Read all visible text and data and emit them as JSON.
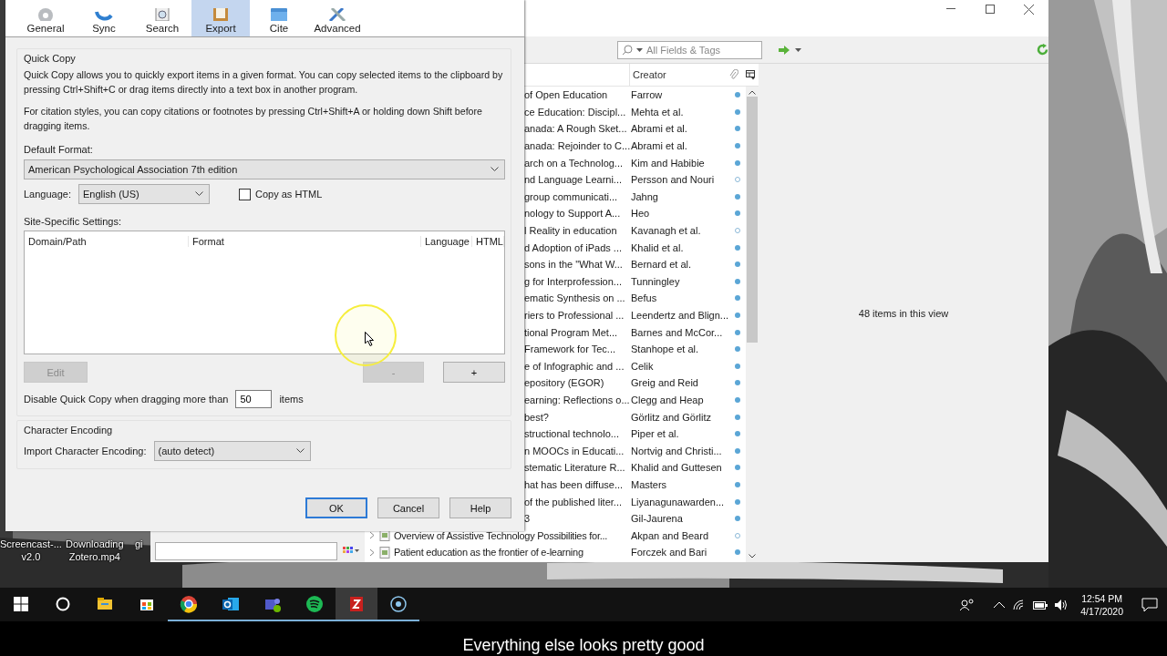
{
  "dialog": {
    "tabs": [
      {
        "label": "General",
        "selected": false
      },
      {
        "label": "Sync",
        "selected": false
      },
      {
        "label": "Search",
        "selected": false
      },
      {
        "label": "Export",
        "selected": true
      },
      {
        "label": "Cite",
        "selected": false
      },
      {
        "label": "Advanced",
        "selected": false
      }
    ],
    "quick_copy": {
      "legend": "Quick Copy",
      "paragraphs": [
        "Quick Copy allows you to quickly export items in a given format. You can copy selected items to the clipboard by pressing Ctrl+Shift+C or drag items directly into a text box in another program.",
        "For citation styles, you can copy citations or footnotes by pressing Ctrl+Shift+A or holding down Shift before dragging items."
      ],
      "default_format_label": "Default Format:",
      "default_format": "American Psychological Association 7th edition",
      "language_label": "Language:",
      "language": "English (US)",
      "copy_as_html": {
        "label": "Copy as HTML",
        "checked": false
      },
      "site_settings_label": "Site-Specific Settings:",
      "site_columns": [
        "Domain/Path",
        "Format",
        "Language",
        "HTML"
      ],
      "buttons": [
        {
          "label": "Edit",
          "disabled": true
        },
        {
          "label": "-",
          "disabled": true
        },
        {
          "label": "+",
          "disabled": false
        }
      ],
      "drag_limit": {
        "before": "Disable Quick Copy when dragging more than",
        "value": "50",
        "after": "items"
      }
    },
    "character_encoding": {
      "legend": "Character Encoding",
      "label": "Import Character Encoding:",
      "value": "(auto detect)"
    },
    "footer_buttons": [
      {
        "label": "OK",
        "default": true
      },
      {
        "label": "Cancel",
        "default": false
      },
      {
        "label": "Help",
        "default": false
      }
    ]
  },
  "zotero": {
    "search": {
      "placeholder": "All Fields & Tags"
    },
    "columns": [
      "Creator"
    ],
    "items": [
      {
        "kind": "clipped",
        "title": "of Open Education",
        "creator": "Farrow",
        "attached": true
      },
      {
        "kind": "clipped",
        "title": "ce Education: Discipl...",
        "creator": "Mehta et al.",
        "attached": true
      },
      {
        "kind": "clipped",
        "title": "anada: A Rough Sket...",
        "creator": "Abrami et al.",
        "attached": true
      },
      {
        "kind": "clipped",
        "title": "anada: Rejoinder to C...",
        "creator": "Abrami et al.",
        "attached": true
      },
      {
        "kind": "clipped",
        "title": "arch on a Technolog...",
        "creator": "Kim and Habibie",
        "attached": true
      },
      {
        "kind": "clipped",
        "title": "nd Language Learni...",
        "creator": "Persson and Nouri",
        "attached": false
      },
      {
        "kind": "clipped",
        "title": "group communicati...",
        "creator": "Jahng",
        "attached": true
      },
      {
        "kind": "clipped",
        "title": "nology to Support A...",
        "creator": "Heo",
        "attached": true
      },
      {
        "kind": "clipped",
        "title": "l Reality in education",
        "creator": "Kavanagh et al.",
        "attached": false
      },
      {
        "kind": "clipped",
        "title": "d Adoption of iPads ...",
        "creator": "Khalid et al.",
        "attached": true
      },
      {
        "kind": "clipped",
        "title": "sons in the \"What W...",
        "creator": "Bernard et al.",
        "attached": true
      },
      {
        "kind": "clipped",
        "title": "g for Interprofession...",
        "creator": "Tunningley",
        "attached": true
      },
      {
        "kind": "clipped",
        "title": "ematic Synthesis on ...",
        "creator": "Befus",
        "attached": true
      },
      {
        "kind": "clipped",
        "title": "riers to Professional ...",
        "creator": "Leendertz and Blign...",
        "attached": true
      },
      {
        "kind": "clipped",
        "title": "tional Program Met...",
        "creator": "Barnes and McCor...",
        "attached": true
      },
      {
        "kind": "clipped",
        "title": "Framework for Tec...",
        "creator": "Stanhope et al.",
        "attached": true
      },
      {
        "kind": "clipped",
        "title": "e of Infographic and ...",
        "creator": "Celik",
        "attached": true
      },
      {
        "kind": "clipped",
        "title": "epository (EGOR)",
        "creator": "Greig and Reid",
        "attached": true
      },
      {
        "kind": "clipped",
        "title": "earning: Reflections o...",
        "creator": "Clegg and Heap",
        "attached": true
      },
      {
        "kind": "clipped",
        "title": "best?",
        "creator": "Görlitz and Görlitz",
        "attached": true
      },
      {
        "kind": "clipped",
        "title": "structional technolo...",
        "creator": "Piper et al.",
        "attached": true
      },
      {
        "kind": "clipped",
        "title": "n MOOCs in Educati...",
        "creator": "Nortvig and Christi...",
        "attached": true
      },
      {
        "kind": "clipped",
        "title": "stematic Literature R...",
        "creator": "Khalid and Guttesen",
        "attached": true
      },
      {
        "kind": "clipped",
        "title": "hat has been diffuse...",
        "creator": "Masters",
        "attached": true
      },
      {
        "kind": "clipped",
        "title": "of the published liter...",
        "creator": "Liyanagunawarden...",
        "attached": true
      },
      {
        "kind": "clipped",
        "title": "3",
        "creator": "Gil-Jaurena",
        "attached": true
      },
      {
        "kind": "full",
        "title": "Overview of Assistive Technology Possibilities for...",
        "creator": "Akpan and Beard",
        "attached": false
      },
      {
        "kind": "full",
        "title": "Patient education as the frontier of e-learning",
        "creator": "Forczek and Bari",
        "attached": true
      }
    ],
    "status": "48 items in this view"
  },
  "desktop_icons": [
    {
      "lines": [
        "Screencast-...",
        "v2.0"
      ]
    },
    {
      "lines": [
        "Downloading",
        "Zotero.mp4"
      ]
    },
    {
      "lines": [
        "gi"
      ]
    }
  ],
  "taskbar": {
    "apps": [
      {
        "open": false,
        "active": false
      },
      {
        "open": false,
        "active": false
      },
      {
        "open": true,
        "active": false
      },
      {
        "open": true,
        "active": false
      },
      {
        "open": true,
        "active": false
      },
      {
        "open": true,
        "active": false
      },
      {
        "open": true,
        "active": true
      },
      {
        "open": true,
        "active": false
      }
    ],
    "time": "12:54 PM",
    "date": "4/17/2020"
  },
  "caption": "Everything else looks pretty good"
}
